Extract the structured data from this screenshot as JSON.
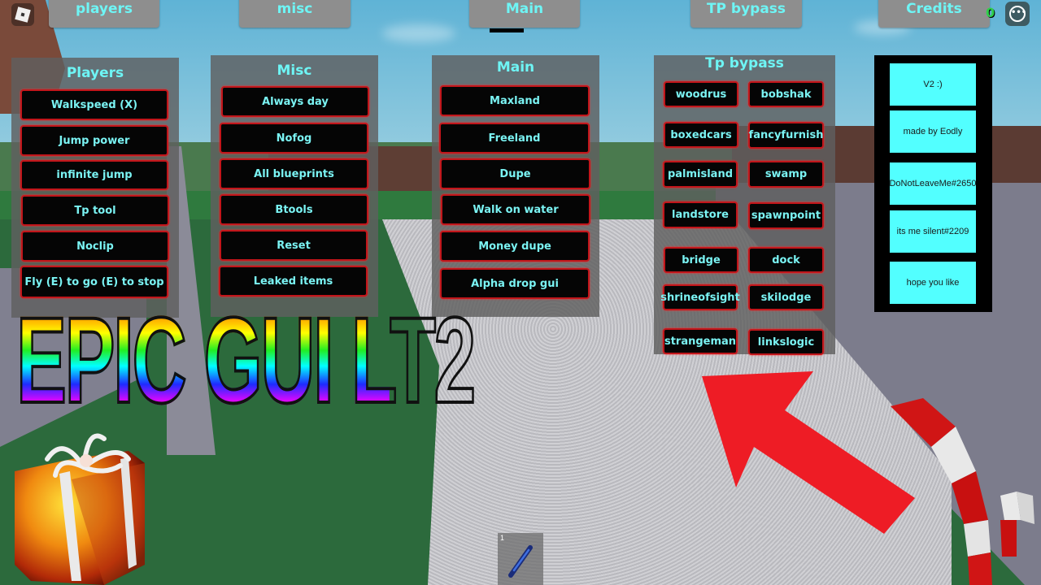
{
  "top_tabs": [
    {
      "label": "players"
    },
    {
      "label": "misc"
    },
    {
      "label": "Main"
    },
    {
      "label": "TP bypass"
    },
    {
      "label": "Credits"
    }
  ],
  "top_bar": {
    "counter_partial": "0",
    "menu_icon": "ellipsis-menu-icon",
    "logo_icon": "roblox-logo-icon"
  },
  "panels": {
    "players": {
      "title": "Players",
      "buttons": [
        "Walkspeed (X)",
        "Jump power",
        "infinite jump",
        "Tp tool",
        "Noclip",
        "Fly (E) to go (E) to stop"
      ]
    },
    "misc": {
      "title": "Misc",
      "buttons": [
        "Always day",
        "Nofog",
        "All blueprints",
        "Btools",
        "Reset",
        "Leaked items"
      ]
    },
    "main": {
      "title": "Main",
      "buttons": [
        "Maxland",
        "Freeland",
        "Dupe",
        "Walk on water",
        "Money dupe",
        "Alpha drop gui"
      ]
    },
    "tp_bypass": {
      "title": "Tp bypass",
      "buttons": [
        "woodrus",
        "bobshak",
        "boxedcars",
        "fancyfurnish",
        "palmisland",
        "swamp",
        "landstore",
        "spawnpoint",
        "bridge",
        "dock",
        "shrineofsight",
        "skilodge",
        "strangeman",
        "linkslogic"
      ]
    },
    "credits": {
      "lines": [
        "V2 :)",
        "made by Eodly",
        "DoNotLeaveMe#2650",
        "its me silent#2209",
        "hope you like"
      ]
    }
  },
  "overlay": {
    "title_text": "EPIC GUI LT2"
  },
  "hotbar": {
    "slots": [
      {
        "number": "1",
        "icon": "pencil-tool-icon"
      }
    ]
  },
  "colors": {
    "button_text": "#7af3f3",
    "button_border": "#c2161b",
    "button_bg": "#050505",
    "panel_bg": "#5f5f5f",
    "tab_bg": "#8e8e8e",
    "credit_box": "#52ffff",
    "arrow": "#ee1c25"
  }
}
